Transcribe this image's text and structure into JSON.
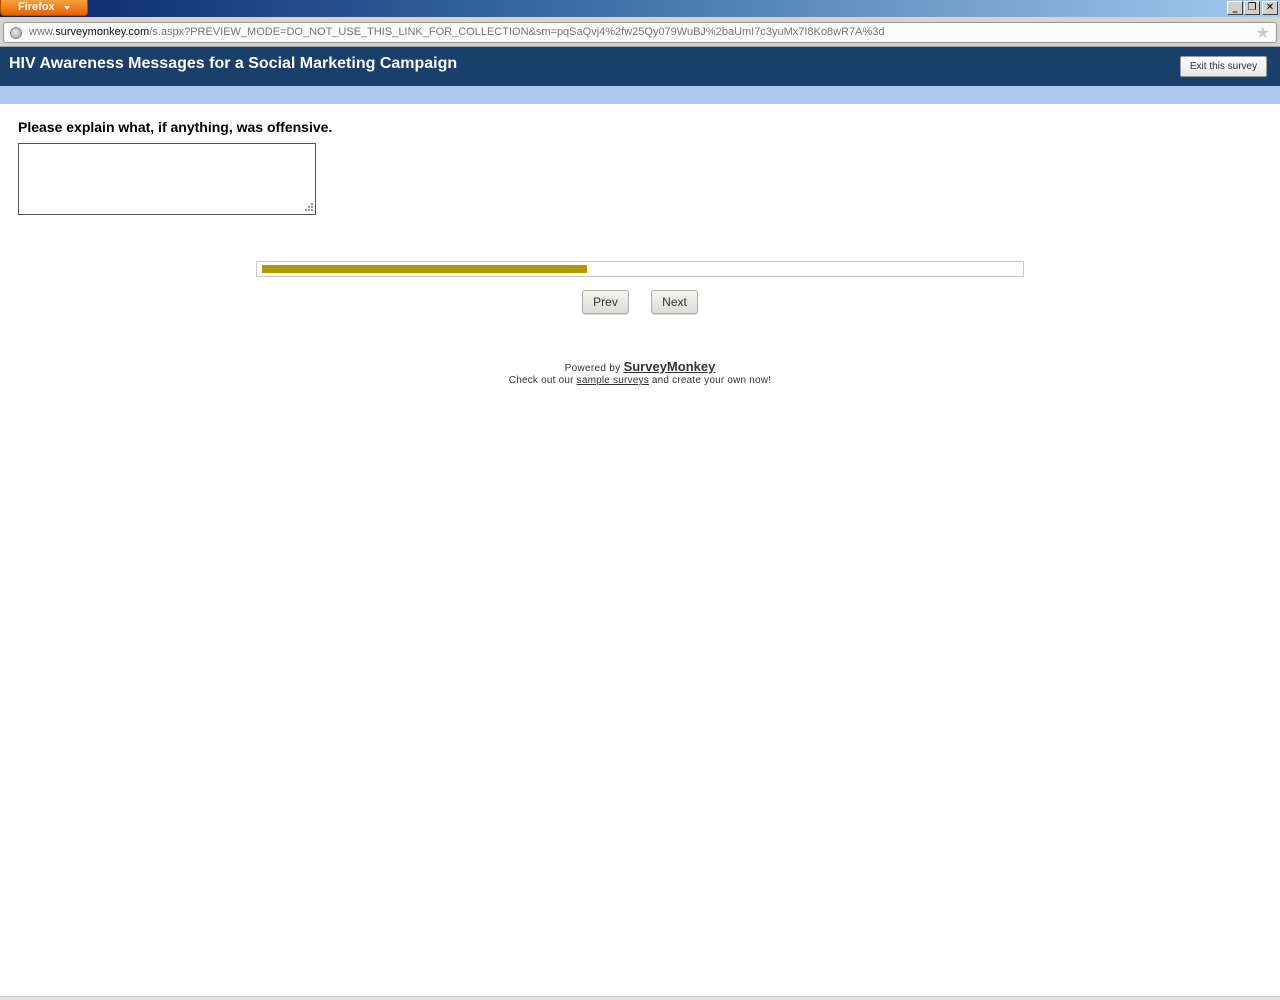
{
  "browser": {
    "menu_label": "Firefox",
    "url_prefix": "www.",
    "url_host": "surveymonkey.com",
    "url_path": "/s.aspx?PREVIEW_MODE=DO_NOT_USE_THIS_LINK_FOR_COLLECTION&sm=pqSaQvj4%2fw25Qy079WuBJ%2baUmI7c3yuMx7I8Ko8wR7A%3d",
    "minimize_glyph": "_",
    "maximize_glyph": "❐",
    "close_glyph": "✕"
  },
  "survey": {
    "title": "HIV Awareness Messages for a Social Marketing Campaign",
    "exit_label": "Exit this survey",
    "question": "Please explain what, if anything, was offensive.",
    "answer_value": "",
    "progress_fraction": 0.43,
    "prev_label": "Prev",
    "next_label": "Next"
  },
  "footer": {
    "powered_prefix": "Powered by",
    "brand": "SurveyMonkey",
    "checkout_prefix": "Check out our",
    "checkout_link": "sample surveys",
    "checkout_suffix": "and create your own now!"
  },
  "colors": {
    "header_bg": "#1a3f6b",
    "strip_bg": "#aec9ef",
    "progress_fill": "#b09800"
  }
}
